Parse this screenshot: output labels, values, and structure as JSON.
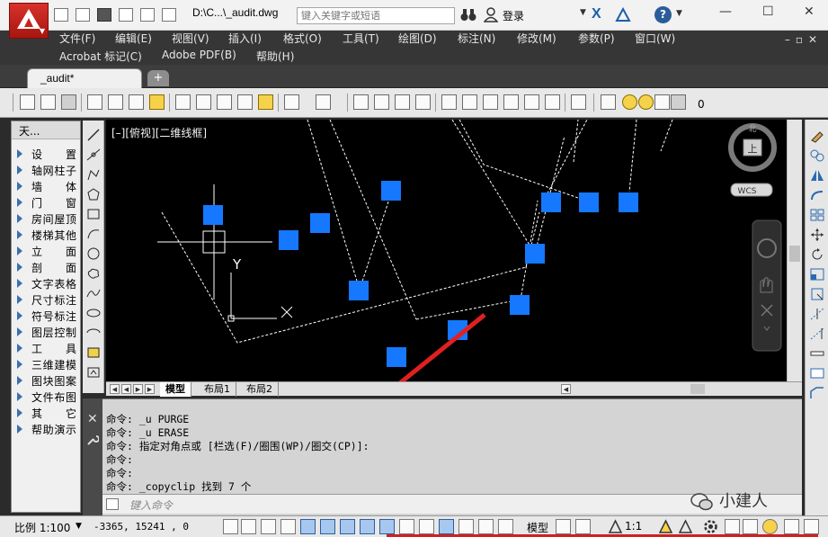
{
  "titlebar": {
    "doc_title": "D:\\C...\\_audit.dwg",
    "search_placeholder": "键入关键字或短语",
    "login": "登录",
    "window_controls": [
      "—",
      "☐",
      "✕"
    ]
  },
  "menubar": {
    "row1": [
      "文件(F)",
      "编辑(E)",
      "视图(V)",
      "插入(I)",
      "格式(O)",
      "工具(T)",
      "绘图(D)",
      "标注(N)",
      "修改(M)",
      "参数(P)",
      "窗口(W)"
    ],
    "row2": [
      "Acrobat 标记(C)",
      "Adobe PDF(B)",
      "帮助(H)"
    ]
  },
  "tabs": {
    "active": "_audit*",
    "new_tab": "+"
  },
  "toolbar": {
    "layer_value": "0"
  },
  "palette": {
    "title": "天...",
    "items": [
      "设置",
      "轴网柱子",
      "墙体",
      "门窗",
      "房间屋顶",
      "楼梯其他",
      "立面",
      "剖面",
      "文字表格",
      "尺寸标注",
      "符号标注",
      "图层控制",
      "工具",
      "三维建模",
      "图块图案",
      "文件布图",
      "其它",
      "帮助演示"
    ]
  },
  "viewport": {
    "label": "[–][俯视][二维线框]",
    "ucs_y": "Y",
    "ucs_x": "X",
    "compass_north": "北",
    "compass_top": "上",
    "wcs": "WCS"
  },
  "layout_tabs": [
    "模型",
    "布局1",
    "布局2"
  ],
  "command": {
    "lines": [
      "命令: _u PURGE",
      "命令: _u ERASE",
      "命令: 指定对角点或 [栏选(F)/圈围(WP)/圈交(CP)]:",
      "命令:",
      "命令:",
      "命令: _copyclip 找到 7 个"
    ],
    "input_placeholder": "键入命令"
  },
  "watermark": "小建人",
  "statusbar": {
    "scale": "比例 1:100",
    "coords": "-3365,  15241 , 0",
    "model": "模型",
    "annotation_scale": "1:1"
  },
  "colors": {
    "grip_blue": "#1677ff",
    "arrow_red": "#e02020"
  }
}
